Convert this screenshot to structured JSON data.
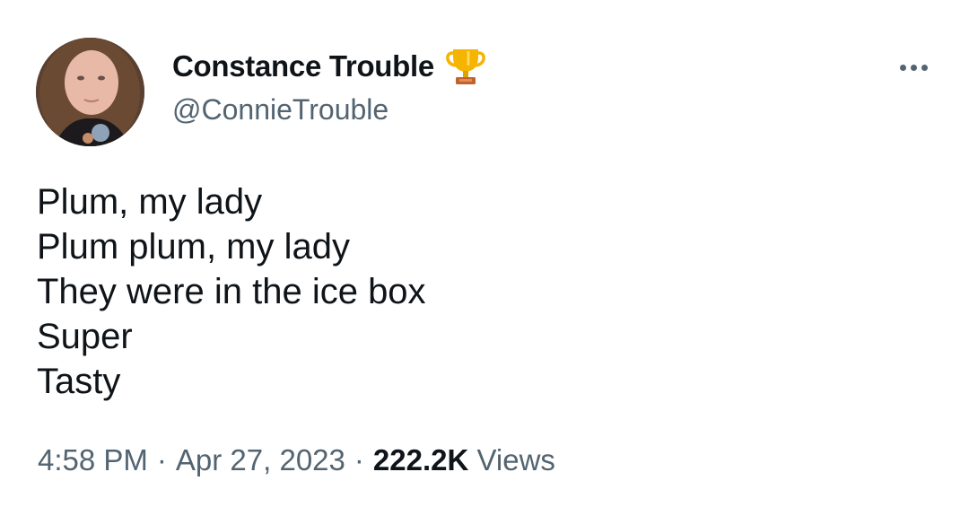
{
  "author": {
    "display_name": "Constance Trouble",
    "handle": "@ConnieTrouble",
    "badge_icon": "trophy-icon",
    "avatar_icon": "profile-photo"
  },
  "more_options_icon": "ellipsis-icon",
  "tweet": {
    "lines": [
      "Plum, my lady",
      "Plum plum, my lady",
      "They were in the ice box",
      "Super",
      "Tasty"
    ]
  },
  "meta": {
    "time": "4:58 PM",
    "separator": "·",
    "date": "Apr 27, 2023",
    "views_count": "222.2K",
    "views_label": "Views"
  },
  "colors": {
    "primary_text": "#0f1419",
    "secondary_text": "#536471",
    "background": "#ffffff",
    "trophy_gold": "#f4b400"
  }
}
